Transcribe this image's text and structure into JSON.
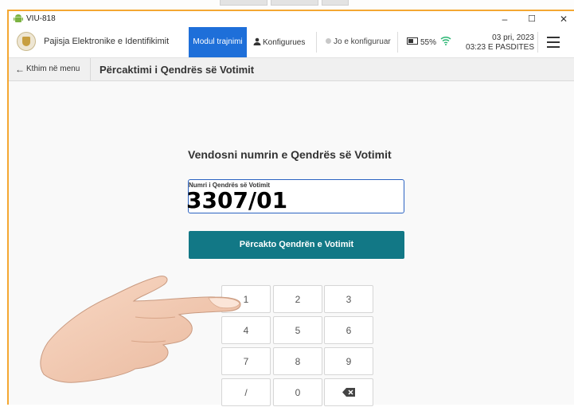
{
  "window": {
    "title": "VIU-818",
    "controls": [
      "–",
      "☐",
      "✕"
    ]
  },
  "header": {
    "app_title": "Pajisja Elektronike e Identifikimit",
    "training_mode": "Modul trajnimi",
    "configure": "Konfigurues",
    "not_configured": "Jo e konfiguruar",
    "battery": "55%",
    "date": "03 pri, 2023",
    "time": "03:23 E PASDITES"
  },
  "subbar": {
    "back_label": "Kthim në menu",
    "page_title": "Përcaktimi i Qendrës së Votimit"
  },
  "form": {
    "heading": "Vendosni numrin e Qendrës së Votimit",
    "field_label": "Numri i Qendrës së Votimit",
    "field_value": "3307/01",
    "submit_label": "Përcakto Qendrën e Votimit"
  },
  "keypad": {
    "keys": [
      "1",
      "2",
      "3",
      "4",
      "5",
      "6",
      "7",
      "8",
      "9",
      "/",
      "0"
    ],
    "delete_icon": "backspace-icon"
  },
  "colors": {
    "accent": "#1e6fd9",
    "submit": "#127886",
    "window_border": "#f4a732",
    "input_border": "#2c63c2"
  }
}
